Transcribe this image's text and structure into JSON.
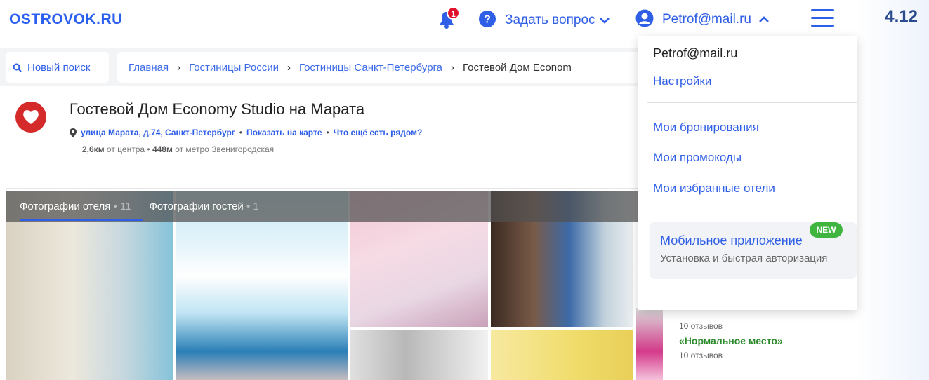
{
  "page_number": "4.12",
  "header": {
    "logo": "OSTROVOK.RU",
    "notifications_badge": "1",
    "ask_question": "Задать вопрос",
    "user_email": "Petrof@mail.ru"
  },
  "search": {
    "new_search": "Новый поиск"
  },
  "breadcrumb": {
    "items": [
      "Главная",
      "Гостиницы России",
      "Гостиницы Санкт-Петербурга",
      "Гостевой Дом Econom"
    ]
  },
  "hotel": {
    "title": "Гостевой Дом Economy Studio на Марата",
    "address": "улица Марата, д.74, Санкт-Петербург",
    "show_on_map": "Показать на карте",
    "nearby": "Что ещё есть рядом?",
    "distance_center_value": "2,6км",
    "distance_center_label": "от центра",
    "distance_metro_value": "448м",
    "distance_metro_label": "от метро Звенигородская"
  },
  "photos": {
    "hotel_tab": "Фотографии отеля",
    "hotel_count": "11",
    "guest_tab": "Фотографии гостей",
    "guest_count": "1"
  },
  "reviews": {
    "first_count": "10 отзывов",
    "second_title": "«Нормальное место»",
    "second_count": "10 отзывов"
  },
  "user_menu": {
    "email": "Petrof@mail.ru",
    "settings": "Настройки",
    "bookings": "Мои бронирования",
    "promocodes": "Мои промокоды",
    "favorites": "Мои избранные отели",
    "mobile_app_title": "Мобильное приложение",
    "mobile_app_subtitle": "Установка и быстрая авторизация",
    "new_badge": "NEW"
  },
  "colors": {
    "brand_blue": "#2f5fe6",
    "badge_red": "#e0112b",
    "new_green": "#3fb53f",
    "review_green": "#2a8a2a"
  }
}
